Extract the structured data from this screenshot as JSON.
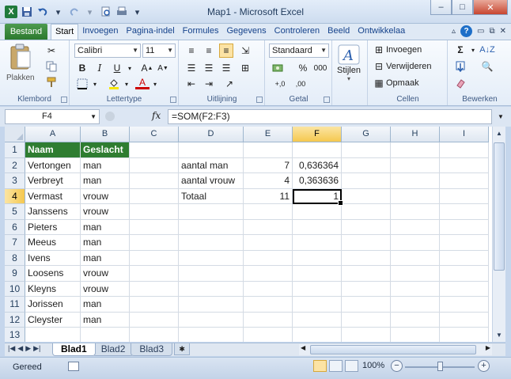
{
  "window": {
    "title": "Map1 - Microsoft Excel",
    "minimize": "–",
    "maximize": "□",
    "close": "✕"
  },
  "ribbon_tabs": {
    "file": "Bestand",
    "tabs": [
      "Start",
      "Invoegen",
      "Pagina-indel",
      "Formules",
      "Gegevens",
      "Controleren",
      "Beeld",
      "Ontwikkelaa"
    ],
    "active_index": 0
  },
  "clipboard": {
    "paste_label": "Plakken",
    "group_label": "Klembord"
  },
  "font": {
    "name": "Calibri",
    "size": "11",
    "group_label": "Lettertype",
    "bold": "B",
    "italic": "I",
    "underline": "U"
  },
  "alignment": {
    "group_label": "Uitlijning"
  },
  "number": {
    "format": "Standaard",
    "percent": "%",
    "thousands": "000",
    "group_label": "Getal"
  },
  "styles": {
    "label": "Stijlen"
  },
  "cells": {
    "insert": "Invoegen",
    "delete": "Verwijderen",
    "format": "Opmaak",
    "group_label": "Cellen"
  },
  "editing": {
    "group_label": "Bewerken",
    "sum": "Σ"
  },
  "formula_bar": {
    "name_box": "F4",
    "fx": "fx",
    "formula": "=SOM(F2:F3)"
  },
  "sheet": {
    "columns": [
      {
        "label": "A",
        "width": 70
      },
      {
        "label": "B",
        "width": 62
      },
      {
        "label": "C",
        "width": 62
      },
      {
        "label": "D",
        "width": 82
      },
      {
        "label": "E",
        "width": 62
      },
      {
        "label": "F",
        "width": 62
      },
      {
        "label": "G",
        "width": 62
      },
      {
        "label": "H",
        "width": 62
      },
      {
        "label": "I",
        "width": 62
      }
    ],
    "selected_column": "F",
    "selected_row": "4",
    "rows": [
      {
        "n": "1",
        "cells": [
          "Naam",
          "Geslacht",
          "",
          "",
          "",
          "",
          "",
          "",
          ""
        ]
      },
      {
        "n": "2",
        "cells": [
          "Vertongen",
          "man",
          "",
          "aantal man",
          "7",
          "0,636364",
          "",
          "",
          ""
        ]
      },
      {
        "n": "3",
        "cells": [
          "Verbreyt",
          "man",
          "",
          "aantal vrouw",
          "4",
          "0,363636",
          "",
          "",
          ""
        ]
      },
      {
        "n": "4",
        "cells": [
          "Vermast",
          "vrouw",
          "",
          "Totaal",
          "11",
          "1",
          "",
          "",
          ""
        ]
      },
      {
        "n": "5",
        "cells": [
          "Janssens",
          "vrouw",
          "",
          "",
          "",
          "",
          "",
          "",
          ""
        ]
      },
      {
        "n": "6",
        "cells": [
          "Pieters",
          "man",
          "",
          "",
          "",
          "",
          "",
          "",
          ""
        ]
      },
      {
        "n": "7",
        "cells": [
          "Meeus",
          "man",
          "",
          "",
          "",
          "",
          "",
          "",
          ""
        ]
      },
      {
        "n": "8",
        "cells": [
          "Ivens",
          "man",
          "",
          "",
          "",
          "",
          "",
          "",
          ""
        ]
      },
      {
        "n": "9",
        "cells": [
          "Loosens",
          "vrouw",
          "",
          "",
          "",
          "",
          "",
          "",
          ""
        ]
      },
      {
        "n": "10",
        "cells": [
          "Kleyns",
          "vrouw",
          "",
          "",
          "",
          "",
          "",
          "",
          ""
        ]
      },
      {
        "n": "11",
        "cells": [
          "Jorissen",
          "man",
          "",
          "",
          "",
          "",
          "",
          "",
          ""
        ]
      },
      {
        "n": "12",
        "cells": [
          "Cleyster",
          "man",
          "",
          "",
          "",
          "",
          "",
          "",
          ""
        ]
      },
      {
        "n": "13",
        "cells": [
          "",
          "",
          "",
          "",
          "",
          "",
          "",
          "",
          ""
        ]
      }
    ]
  },
  "sheet_tabs": [
    "Blad1",
    "Blad2",
    "Blad3"
  ],
  "status": {
    "ready": "Gereed",
    "zoom": "100%"
  },
  "colors": {
    "header_green": "#2f7d31",
    "cell_green": "#3b8a3d",
    "file_tab": "#2c7a2e"
  }
}
